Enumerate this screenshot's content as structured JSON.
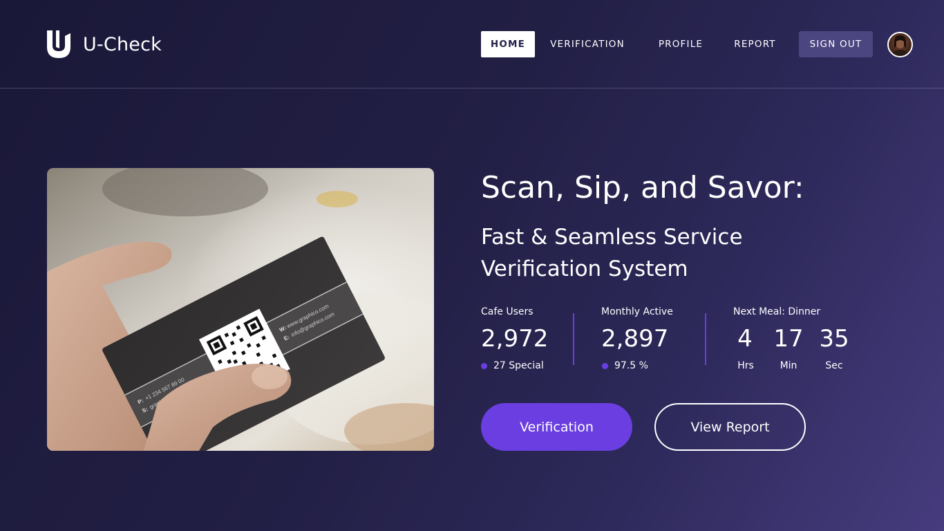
{
  "app": {
    "name": "U-Check"
  },
  "nav": {
    "home": "HOME",
    "verification": "VERIFICATION",
    "profile": "PROFILE",
    "report": "REPORT",
    "sign_out": "SIGN OUT"
  },
  "hero": {
    "title": "Scan, Sip, and Savor:",
    "subtitle_line1": "Fast & Seamless Service",
    "subtitle_line2": "Verification System"
  },
  "stats": {
    "cafe_users": {
      "label": "Cafe Users",
      "value": "2,972",
      "sub": "27 Special"
    },
    "monthly_active": {
      "label": "Monthly Active",
      "value": "2,897",
      "sub": "97.5 %"
    },
    "next_meal": {
      "label": "Next Meal: Dinner",
      "hours": "4",
      "hours_unit": "Hrs",
      "minutes": "17",
      "minutes_unit": "Min",
      "seconds": "35",
      "seconds_unit": "Sec"
    }
  },
  "buttons": {
    "verification": "Verification",
    "view_report": "View Report"
  },
  "card": {
    "phone_label": "P:",
    "phone": "+1 234 567 89 00",
    "social_label": "S:",
    "social": "graphicodesign",
    "web_label": "W:",
    "web": "www.graphico.com",
    "email_label": "E:",
    "email": "info@graphico.com"
  },
  "colors": {
    "accent": "#6a3ee0",
    "nav_signout_bg": "#4b4580",
    "bg_dark": "#1a1838"
  },
  "icons": {
    "logo": "u-logo-icon",
    "avatar": "user-avatar"
  }
}
